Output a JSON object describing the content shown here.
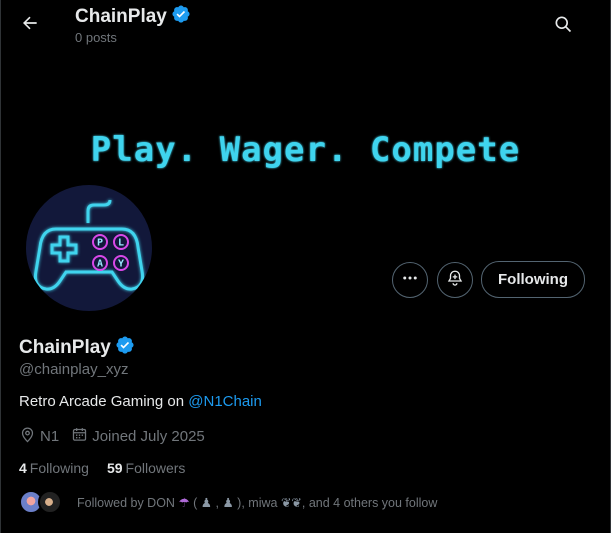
{
  "header": {
    "name": "ChainPlay",
    "posts": "0 posts",
    "back_icon": "arrow-left-icon",
    "search_icon": "search-icon"
  },
  "banner": {
    "text": "Play. Wager. Compete"
  },
  "avatar": {
    "letters": [
      "P",
      "L",
      "A",
      "Y"
    ],
    "glow_color": "#3fd4ee",
    "button_color": "#d848e8"
  },
  "actions": {
    "more_icon": "more-horizontal-icon",
    "notify_icon": "bell-plus-icon",
    "following_label": "Following"
  },
  "profile": {
    "name": "ChainPlay",
    "handle": "@chainplay_xyz",
    "bio_text": "Retro Arcade Gaming on ",
    "bio_mention": "@N1Chain",
    "location": "N1",
    "joined": "Joined July 2025",
    "following_count": "4",
    "following_label": "Following",
    "followers_count": "59",
    "followers_label": "Followers",
    "followed_by_prefix": "Followed by DON",
    "followed_by_mid1": "(",
    "followed_by_mid2": ",",
    "followed_by_mid3": "), miwa",
    "followed_by_suffix": ", and 4 others you follow"
  },
  "colors": {
    "accent": "#1d9bf0",
    "verified": "#1d9bf0",
    "muted": "#71767b",
    "text": "#e7e9ea"
  }
}
